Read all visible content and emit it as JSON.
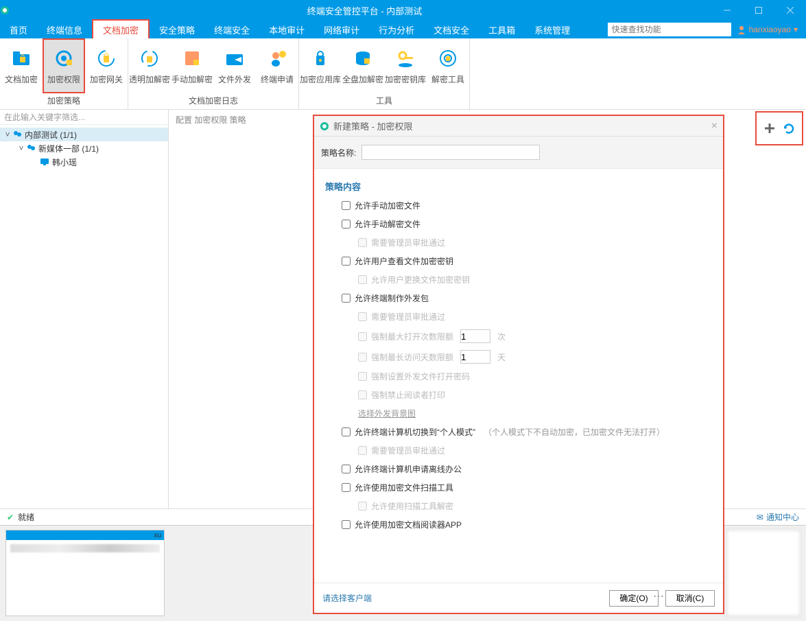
{
  "titlebar": {
    "title": "终端安全管控平台 - 内部测试"
  },
  "menu": {
    "tabs": [
      "首页",
      "终端信息",
      "文档加密",
      "安全策略",
      "终端安全",
      "本地审计",
      "网络审计",
      "行为分析",
      "文档安全",
      "工具箱",
      "系统管理"
    ],
    "search_placeholder": "快速查找功能",
    "user": "hanxiaoyao"
  },
  "ribbon": {
    "group1": {
      "label": "加密策略",
      "items": [
        "文档加密",
        "加密权限",
        "加密网关"
      ]
    },
    "group2": {
      "label": "文档加密日志",
      "items": [
        "透明加解密",
        "手动加解密",
        "文件外发",
        "终端申请"
      ]
    },
    "group3": {
      "label": "工具",
      "items": [
        "加密应用库",
        "全盘加解密",
        "加密密钥库",
        "解密工具"
      ]
    }
  },
  "sidebar": {
    "filter_placeholder": "在此输入关键字筛选...",
    "tree": {
      "root": "内部测试 (1/1)",
      "child1": "新媒体一部 (1/1)",
      "leaf": "韩小瑶"
    }
  },
  "breadcrumb": "配置 加密权限 策略",
  "dialog": {
    "title": "新建策略 - 加密权限",
    "name_label": "策略名称:",
    "section_title": "策略内容",
    "opts": {
      "o1": "允许手动加密文件",
      "o2": "允许手动解密文件",
      "o2a": "需要管理员审批通过",
      "o3": "允许用户查看文件加密密钥",
      "o3a": "允许用户更换文件加密密钥",
      "o4": "允许终端制作外发包",
      "o4a": "需要管理员审批通过",
      "o4b": "强制最大打开次数限额",
      "o4b_val": "1",
      "o4b_unit": "次",
      "o4c": "强制最长访问天数限额",
      "o4c_val": "1",
      "o4c_unit": "天",
      "o4d": "强制设置外发文件打开密码",
      "o4e": "强制禁止阅读者打印",
      "o4link": "选择外发背景图",
      "o5": "允许终端计算机切换到“个人模式”",
      "o5_hint": "（个人模式下不自动加密，已加密文件无法打开）",
      "o5a": "需要管理员审批通过",
      "o6": "允许终端计算机申请离线办公",
      "o7": "允许使用加密文件扫描工具",
      "o7a": "允许使用扫描工具解密",
      "o8": "允许使用加密文档阅读器APP"
    },
    "footer_link": "请选择客户端",
    "ok": "确定(O)",
    "cancel": "取消(C)"
  },
  "status": {
    "text": "就绪",
    "notif": "通知中心"
  },
  "taskbar": {
    "xu": "xu"
  }
}
